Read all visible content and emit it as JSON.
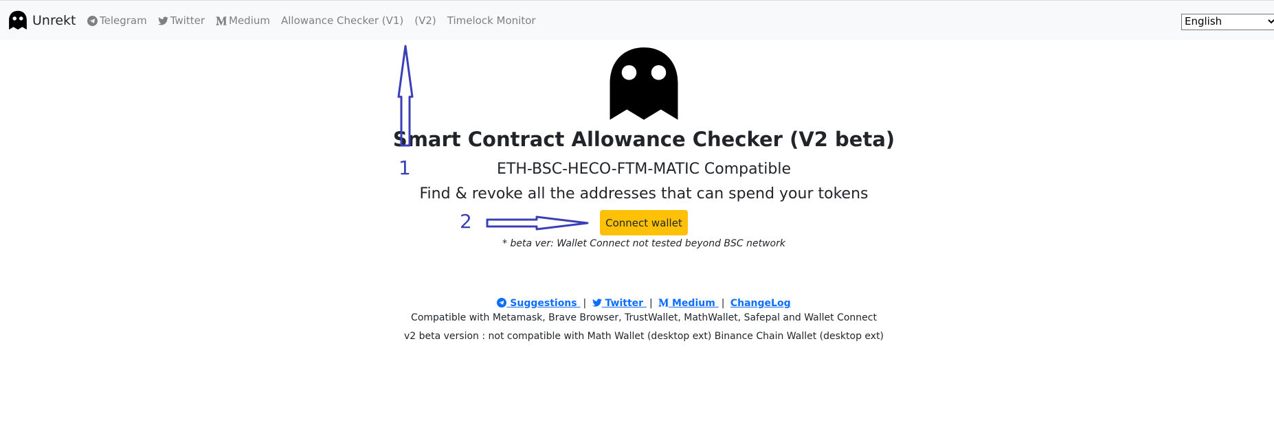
{
  "navbar": {
    "brand": "Unrekt",
    "links": [
      {
        "label": "Telegram",
        "icon": "telegram-icon"
      },
      {
        "label": "Twitter",
        "icon": "twitter-icon"
      },
      {
        "label": "Medium",
        "icon": "medium-icon"
      },
      {
        "label": "Allowance Checker (V1)"
      },
      {
        "label": "(V2)"
      },
      {
        "label": "Timelock Monitor"
      }
    ],
    "language": "English"
  },
  "main": {
    "logo_icon": "ghost-icon",
    "title": "Smart Contract Allowance Checker (V2 beta)",
    "subtitle": "ETH-BSC-HECO-FTM-MATIC Compatible",
    "tagline": "Find & revoke all the addresses that can spend your tokens",
    "connect_label": "Connect wallet",
    "beta_note": "* beta ver: Wallet Connect not tested beyond BSC network"
  },
  "footer": {
    "links": {
      "suggestions": "Suggestions",
      "twitter": "Twitter",
      "medium": "Medium",
      "changelog": "ChangeLog"
    },
    "separator": "|",
    "compat": "Compatible with Metamask, Brave Browser, TrustWallet, MathWallet, Safepal and Wallet Connect",
    "v2_note": "v2 beta version : not compatible with Math Wallet (desktop ext) Binance Chain Wallet (desktop ext)"
  },
  "annotations": {
    "one": "1",
    "two": "2",
    "color": "#3a3fb8"
  },
  "colors": {
    "accent": "#ffc107",
    "link": "#0d6efd",
    "navbar_bg": "#f8f9fa"
  }
}
